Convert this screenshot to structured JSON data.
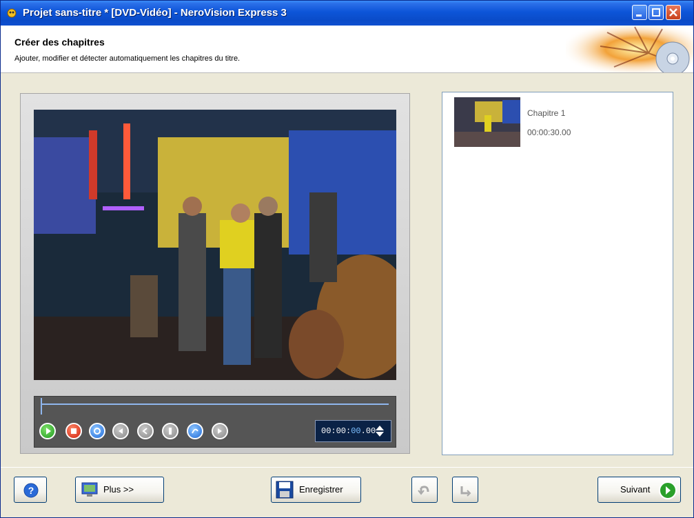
{
  "window": {
    "title": "Projet sans-titre * [DVD-Vidéo] - NeroVision Express 3"
  },
  "header": {
    "title": "Créer des chapitres",
    "subtitle": "Ajouter, modifier et détecter automatiquement les chapitres du titre."
  },
  "player": {
    "timecode_prefix": "00:00:",
    "timecode_seconds": "00",
    "timecode_frames": ".00"
  },
  "chapters": [
    {
      "name": "Chapitre 1",
      "time": "00:00:30.00"
    }
  ],
  "footer": {
    "plus_label": "Plus >>",
    "save_label": "Enregistrer",
    "next_label": "Suivant"
  },
  "colors": {
    "titlebar": "#0d55d8",
    "background": "#ece9d8",
    "play": "#1e9a1e",
    "stop": "#d0200c",
    "accent_blue": "#1e6ad8"
  },
  "icons": [
    "app-icon",
    "minimize-icon",
    "maximize-icon",
    "close-icon",
    "play-icon",
    "stop-icon",
    "help-icon",
    "plus-icon",
    "save-icon",
    "undo-icon",
    "redo-icon",
    "next-arrow-icon"
  ]
}
